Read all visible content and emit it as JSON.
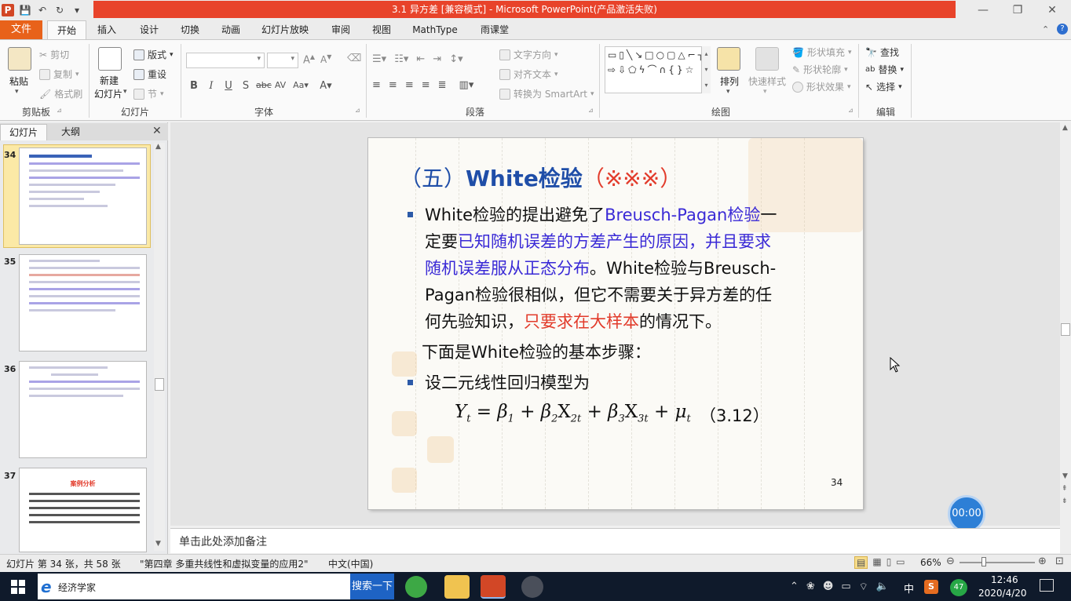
{
  "window": {
    "title": "3.1 异方差 [兼容模式] - Microsoft PowerPoint(产品激活失败)",
    "app_icon": "P"
  },
  "tabs": [
    "文件",
    "开始",
    "插入",
    "设计",
    "切换",
    "动画",
    "幻灯片放映",
    "审阅",
    "视图",
    "MathType",
    "雨课堂"
  ],
  "ribbon": {
    "clipboard": {
      "label": "剪贴板",
      "paste": "粘贴",
      "cut": "剪切",
      "copy": "复制",
      "format_painter": "格式刷"
    },
    "slides": {
      "label": "幻灯片",
      "new_slide_1": "新建",
      "new_slide_2": "幻灯片",
      "layout": "版式",
      "reset": "重设",
      "section": "节"
    },
    "font": {
      "label": "字体"
    },
    "paragraph": {
      "label": "段落",
      "text_direction": "文字方向",
      "align_text": "对齐文本",
      "smartart": "转换为 SmartArt"
    },
    "drawing": {
      "label": "绘图",
      "arrange": "排列",
      "quick_styles": "快速样式",
      "shape_fill": "形状填充",
      "shape_outline": "形状轮廓",
      "shape_effects": "形状效果"
    },
    "editing": {
      "label": "编辑",
      "find": "查找",
      "replace": "替换",
      "select": "选择"
    }
  },
  "left_pane": {
    "tab_slides": "幻灯片",
    "tab_outline": "大纲",
    "slide_numbers": [
      "34",
      "35",
      "36",
      "37"
    ]
  },
  "slide": {
    "title_paren_open": "（五）",
    "title_main": "White检验",
    "title_marks": "（※※※）",
    "p1_a": "White检验的提出避免了",
    "p1_b": "Breusch-Pagan检验",
    "p1_c": "一",
    "p1_d": "定要",
    "p1_e": "已知随机误差的方差产生的原因，并且要求",
    "p1_f": "随机误差服从正态分布",
    "p1_g": "。White检验与Breusch-",
    "p1_h": "Pagan检验很相似，但它不需要关于异方差的任",
    "p1_i": "何先验知识，",
    "p1_j": "只要求在大样本",
    "p1_k": "的情况下。",
    "p2": "下面是White检验的基本步骤：",
    "p3": "设二元线性回归模型为",
    "eq_number": "（3.12）",
    "page_number": "34"
  },
  "thumb37_heading": "案例分析",
  "notes_placeholder": "单击此处添加备注",
  "status": {
    "slide_info": "幻灯片 第 34 张，共 58 张",
    "theme": "\"第四章 多重共线性和虚拟变量的应用2\"",
    "language": "中文(中国)",
    "zoom": "66%"
  },
  "timer": "00:00",
  "taskbar": {
    "search_text": "经济学家",
    "search_button": "搜索一下",
    "time": "12:46",
    "date": "2020/4/20",
    "ime": "中",
    "badge": "47"
  }
}
